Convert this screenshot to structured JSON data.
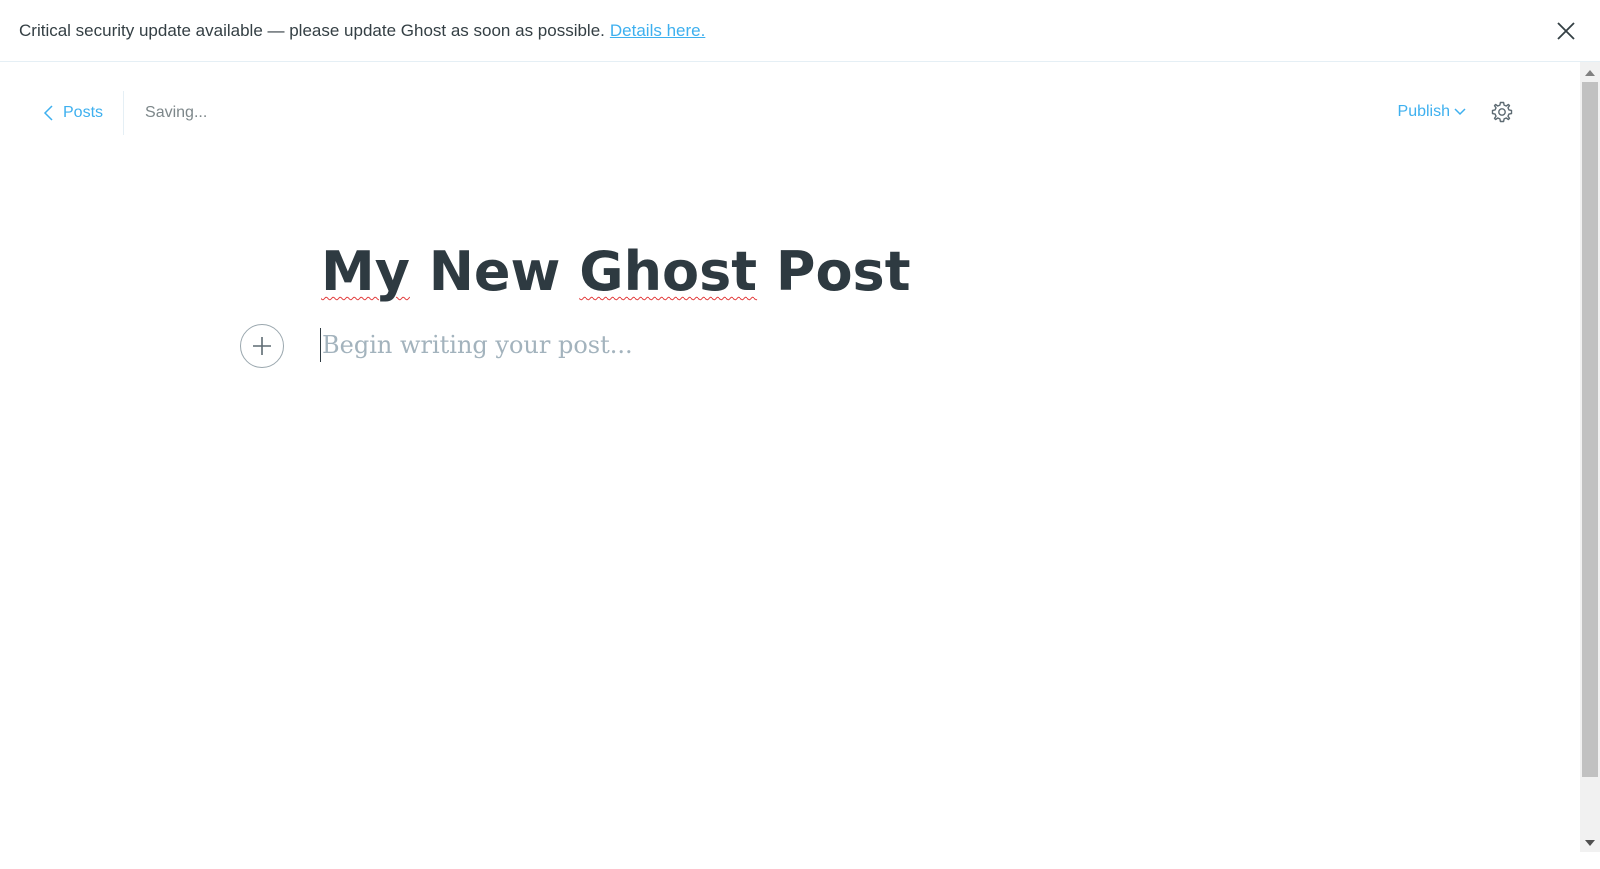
{
  "alert": {
    "message": "Critical security update available — please update Ghost as soon as possible.",
    "link_label": "Details here.",
    "close_icon": "close-icon"
  },
  "editor": {
    "back_label": "Posts",
    "back_icon": "chevron-left-icon",
    "status": "Saving...",
    "publish_label": "Publish",
    "publish_icon": "chevron-down-icon",
    "settings_icon": "gear-icon",
    "title_word_1": "My",
    "title_word_2": " New ",
    "title_word_3": "Ghost",
    "title_word_4": " Post",
    "body_placeholder": "Begin writing your post...",
    "add_card_icon": "plus-icon"
  },
  "colors": {
    "accent": "#3eb0ef",
    "title": "#2e3a41",
    "placeholder": "#a3b3bd",
    "spellcheck": "#e23b3b"
  }
}
